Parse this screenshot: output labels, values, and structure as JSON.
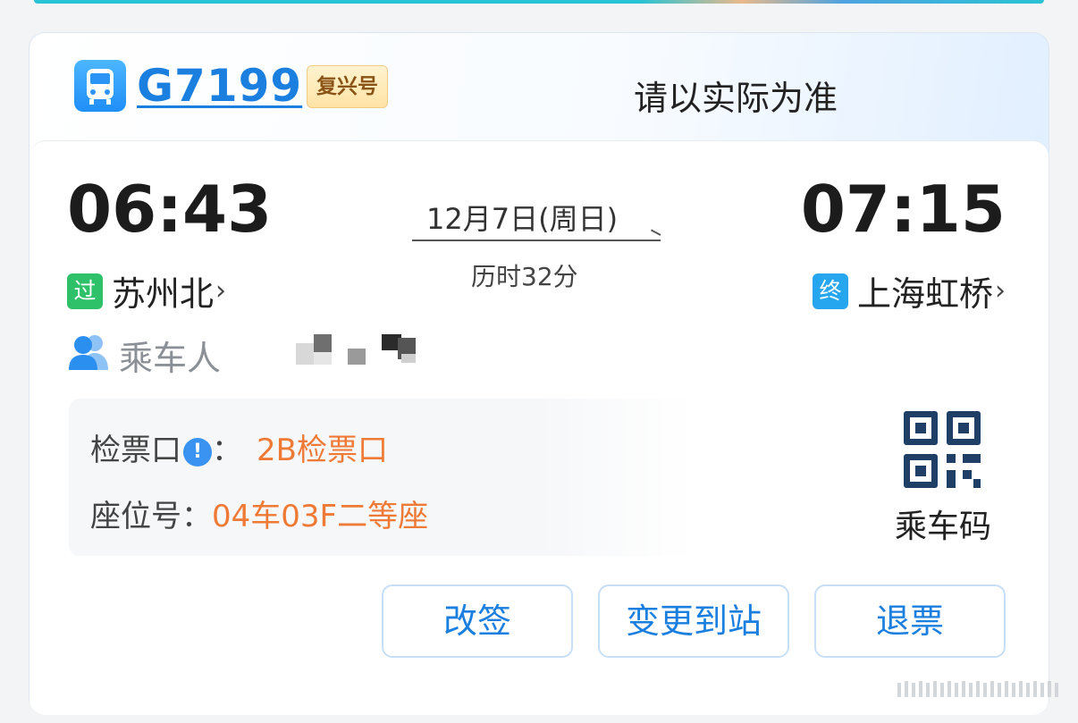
{
  "header": {
    "train_icon": "train-icon",
    "train_number": "G7199",
    "train_type": "复兴号",
    "notice": "请以实际为准"
  },
  "journey": {
    "departure_time": "06:43",
    "arrival_time": "07:15",
    "date": "12月7日(周日)",
    "duration": "历时32分",
    "departure_station": {
      "badge": "过",
      "name": "苏州北",
      "chevron": "›"
    },
    "arrival_station": {
      "badge": "终",
      "name": "上海虹桥",
      "chevron": "›"
    }
  },
  "passenger": {
    "icon": "people-icon",
    "label": "乘车人"
  },
  "info": {
    "gate_label": "检票口",
    "gate_info_icon": "!",
    "gate_colon": "：",
    "gate_value": "2B检票口",
    "seat_label": "座位号：",
    "seat_value": "04车03F二等座"
  },
  "qr": {
    "icon": "qr-code-icon",
    "label": "乘车码"
  },
  "actions": {
    "change": "改签",
    "change_station": "变更到站",
    "refund": "退票"
  },
  "colors": {
    "accent_blue": "#1b7fe0",
    "orange_value": "#ef7a35",
    "pass_badge": "#2fc06a",
    "end_badge": "#27a6f0"
  }
}
